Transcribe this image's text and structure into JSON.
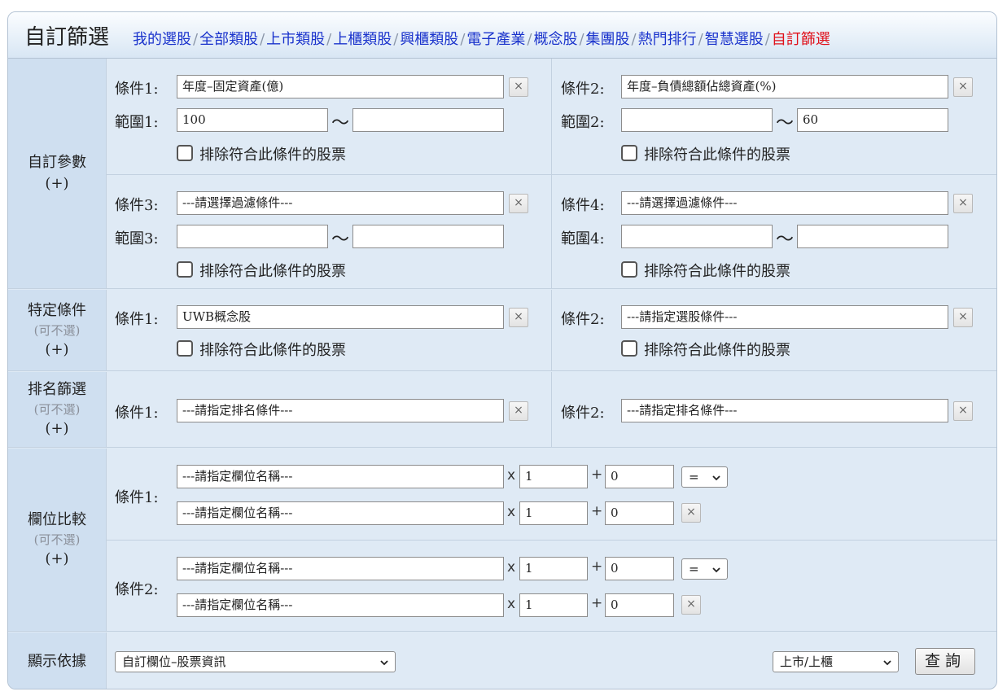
{
  "header": {
    "title": "自訂篩選",
    "nav": [
      "我的選股",
      "全部類股",
      "上市類股",
      "上櫃類股",
      "興櫃類股",
      "電子產業",
      "概念股",
      "集團股",
      "熱門排行",
      "智慧選股",
      "自訂篩選"
    ],
    "active_index": 10,
    "separator": "/"
  },
  "common": {
    "exclude_label": "排除符合此條件的股票",
    "clear_glyph": "×",
    "tilde": "〜",
    "optional": "(可不選)",
    "plus": "(+)"
  },
  "custom_params": {
    "label": "自訂參數",
    "c1_label": "條件1:",
    "c1_value": "年度–固定資產(億)",
    "r1_label": "範圍1:",
    "r1_min": "100",
    "r1_max": "",
    "c2_label": "條件2:",
    "c2_value": "年度–負債總額佔總資產(%)",
    "r2_label": "範圍2:",
    "r2_min": "",
    "r2_max": "60",
    "c3_label": "條件3:",
    "c3_value": "---請選擇過濾條件---",
    "r3_label": "範圍3:",
    "r3_min": "",
    "r3_max": "",
    "c4_label": "條件4:",
    "c4_value": "---請選擇過濾條件---",
    "r4_label": "範圍4:",
    "r4_min": "",
    "r4_max": ""
  },
  "specific": {
    "label": "特定條件",
    "c1_label": "條件1:",
    "c1_value": "UWB概念股",
    "c2_label": "條件2:",
    "c2_value": "---請指定選股條件---"
  },
  "ranking": {
    "label": "排名篩選",
    "c1_label": "條件1:",
    "c1_value": "---請指定排名條件---",
    "c2_label": "條件2:",
    "c2_value": "---請指定排名條件---"
  },
  "compare": {
    "label": "欄位比較",
    "c1_label": "條件1:",
    "c2_label": "條件2:",
    "field_placeholder": "---請指定欄位名稱---",
    "times": "x",
    "plus_op": "+",
    "multiplier": "1",
    "offset": "0",
    "operator": "="
  },
  "display": {
    "label": "顯示依據",
    "basis": "自訂欄位–股票資訊",
    "market": "上市/上櫃",
    "query_label": "查詢"
  }
}
